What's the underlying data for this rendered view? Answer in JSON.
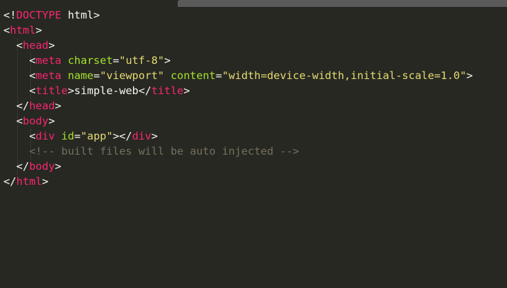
{
  "editor": {
    "lines": [
      {
        "indent": "",
        "tokens": [
          {
            "t": "punc",
            "v": "<!"
          },
          {
            "t": "tag",
            "v": "DOCTYPE"
          },
          {
            "t": "punc",
            "v": " html>"
          }
        ]
      },
      {
        "indent": "",
        "tokens": [
          {
            "t": "punc",
            "v": "<"
          },
          {
            "t": "tag",
            "v": "html"
          },
          {
            "t": "punc",
            "v": ">"
          }
        ]
      },
      {
        "indent": "  ",
        "tokens": [
          {
            "t": "punc",
            "v": "<"
          },
          {
            "t": "tag",
            "v": "head"
          },
          {
            "t": "punc",
            "v": ">"
          }
        ]
      },
      {
        "indent": "    ",
        "tokens": [
          {
            "t": "punc",
            "v": "<"
          },
          {
            "t": "tag",
            "v": "meta"
          },
          {
            "t": "punc",
            "v": " "
          },
          {
            "t": "attr",
            "v": "charset"
          },
          {
            "t": "punc",
            "v": "="
          },
          {
            "t": "str",
            "v": "\"utf-8\""
          },
          {
            "t": "punc",
            "v": ">"
          }
        ]
      },
      {
        "indent": "    ",
        "tokens": [
          {
            "t": "punc",
            "v": "<"
          },
          {
            "t": "tag",
            "v": "meta"
          },
          {
            "t": "punc",
            "v": " "
          },
          {
            "t": "attr",
            "v": "name"
          },
          {
            "t": "punc",
            "v": "="
          },
          {
            "t": "str",
            "v": "\"viewport\""
          },
          {
            "t": "punc",
            "v": " "
          },
          {
            "t": "attr",
            "v": "content"
          },
          {
            "t": "punc",
            "v": "="
          },
          {
            "t": "str",
            "v": "\"width=device-width,initial-scale=1.0\""
          },
          {
            "t": "punc",
            "v": ">"
          }
        ]
      },
      {
        "indent": "    ",
        "tokens": [
          {
            "t": "punc",
            "v": "<"
          },
          {
            "t": "tag",
            "v": "title"
          },
          {
            "t": "punc",
            "v": ">simple-web</"
          },
          {
            "t": "tag",
            "v": "title"
          },
          {
            "t": "punc",
            "v": ">"
          }
        ]
      },
      {
        "indent": "  ",
        "tokens": [
          {
            "t": "punc",
            "v": "</"
          },
          {
            "t": "tag",
            "v": "head"
          },
          {
            "t": "punc",
            "v": ">"
          }
        ]
      },
      {
        "indent": "  ",
        "tokens": [
          {
            "t": "punc",
            "v": "<"
          },
          {
            "t": "tag",
            "v": "body"
          },
          {
            "t": "punc",
            "v": ">"
          }
        ]
      },
      {
        "indent": "    ",
        "tokens": [
          {
            "t": "punc",
            "v": "<"
          },
          {
            "t": "tag",
            "v": "div"
          },
          {
            "t": "punc",
            "v": " "
          },
          {
            "t": "attr",
            "v": "id"
          },
          {
            "t": "punc",
            "v": "="
          },
          {
            "t": "str",
            "v": "\"app\""
          },
          {
            "t": "punc",
            "v": "></"
          },
          {
            "t": "tag",
            "v": "div"
          },
          {
            "t": "punc",
            "v": ">"
          }
        ]
      },
      {
        "indent": "    ",
        "tokens": [
          {
            "t": "cmt",
            "v": "<!-- built files will be auto injected -->"
          }
        ]
      },
      {
        "indent": "  ",
        "tokens": [
          {
            "t": "punc",
            "v": "</"
          },
          {
            "t": "tag",
            "v": "body"
          },
          {
            "t": "punc",
            "v": ">"
          }
        ]
      },
      {
        "indent": "",
        "tokens": [
          {
            "t": "punc",
            "v": "</"
          },
          {
            "t": "tag",
            "v": "html"
          },
          {
            "t": "punc",
            "v": ">"
          }
        ]
      }
    ]
  },
  "colors": {
    "background": "#272822",
    "tag": "#f92672",
    "attribute": "#a6e22e",
    "string": "#e6db74",
    "comment": "#75715e",
    "text": "#f8f8f2"
  }
}
